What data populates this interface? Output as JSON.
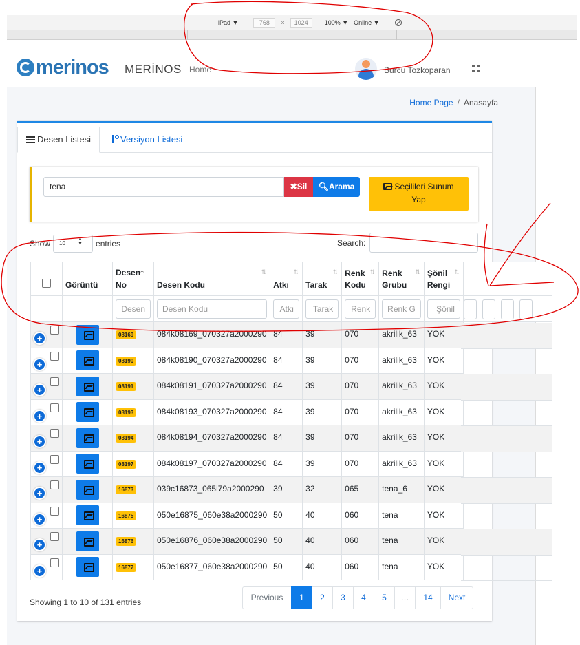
{
  "devtools": {
    "device": "iPad ▼",
    "width": "768",
    "times": "×",
    "height": "1024",
    "zoom": "100% ▼",
    "network": "Online ▼"
  },
  "navbar": {
    "logo_word": "merinos",
    "brand_text": "MERİNOS",
    "home_link": "Home",
    "username": "Burcu Tozkoparan"
  },
  "breadcrumb": {
    "home": "Home Page",
    "separator": "/",
    "current": "Anasayfa"
  },
  "tabs": [
    {
      "label": "Desen Listesi"
    },
    {
      "label": "Versiyon Listesi"
    }
  ],
  "filter": {
    "search_value": "tena",
    "clear_label": "Sil",
    "search_label": "Arama",
    "present_label_1": "Seçilileri Sunum",
    "present_label_2": "Yap"
  },
  "table_controls": {
    "show_label": "Show",
    "page_length": "10",
    "entries_label": "entries",
    "search_label": "Search:"
  },
  "table": {
    "headers": {
      "view": "Görüntü",
      "pattern_no_1": "Desen",
      "pattern_no_2": "No",
      "pattern_code": "Desen Kodu",
      "weft": "Atkı",
      "reed": "Tarak",
      "color_code_1": "Renk",
      "color_code_2": "Kodu",
      "color_group_1": "Renk",
      "color_group_2": "Grubu",
      "shonil_1": "Şönil",
      "shonil_2": "Rengi"
    },
    "filter_placeholders": {
      "pattern_no": "Desen",
      "pattern_code": "Desen Kodu",
      "weft": "Atkı",
      "reed": "Tarak",
      "color_code": "Renk",
      "color_group": "Renk G",
      "shonil": "Şönil"
    },
    "rows": [
      {
        "no": "08169",
        "code": "084k08169_070327a2000290",
        "weft": "84",
        "reed": "39",
        "color_code": "070",
        "color_group": "akrilik_63",
        "shonil": "YOK"
      },
      {
        "no": "08190",
        "code": "084k08190_070327a2000290",
        "weft": "84",
        "reed": "39",
        "color_code": "070",
        "color_group": "akrilik_63",
        "shonil": "YOK"
      },
      {
        "no": "08191",
        "code": "084k08191_070327a2000290",
        "weft": "84",
        "reed": "39",
        "color_code": "070",
        "color_group": "akrilik_63",
        "shonil": "YOK"
      },
      {
        "no": "08193",
        "code": "084k08193_070327a2000290",
        "weft": "84",
        "reed": "39",
        "color_code": "070",
        "color_group": "akrilik_63",
        "shonil": "YOK"
      },
      {
        "no": "08194",
        "code": "084k08194_070327a2000290",
        "weft": "84",
        "reed": "39",
        "color_code": "070",
        "color_group": "akrilik_63",
        "shonil": "YOK"
      },
      {
        "no": "08197",
        "code": "084k08197_070327a2000290",
        "weft": "84",
        "reed": "39",
        "color_code": "070",
        "color_group": "akrilik_63",
        "shonil": "YOK"
      },
      {
        "no": "16873",
        "code": "039c16873_065i79a2000290",
        "weft": "39",
        "reed": "32",
        "color_code": "065",
        "color_group": "tena_6",
        "shonil": "YOK"
      },
      {
        "no": "16875",
        "code": "050e16875_060e38a2000290",
        "weft": "50",
        "reed": "40",
        "color_code": "060",
        "color_group": "tena",
        "shonil": "YOK"
      },
      {
        "no": "16876",
        "code": "050e16876_060e38a2000290",
        "weft": "50",
        "reed": "40",
        "color_code": "060",
        "color_group": "tena",
        "shonil": "YOK"
      },
      {
        "no": "16877",
        "code": "050e16877_060e38a2000290",
        "weft": "50",
        "reed": "40",
        "color_code": "060",
        "color_group": "tena",
        "shonil": "YOK"
      }
    ]
  },
  "footer": {
    "info": "Showing 1 to 10 of 131 entries",
    "previous": "Previous",
    "pages": [
      "1",
      "2",
      "3",
      "4",
      "5",
      "…",
      "14"
    ],
    "next": "Next",
    "current_page": "1"
  },
  "colors": {
    "primary": "#0e7be8",
    "danger": "#dc3545",
    "warning": "#ffc107",
    "annotation": "#e00000"
  }
}
